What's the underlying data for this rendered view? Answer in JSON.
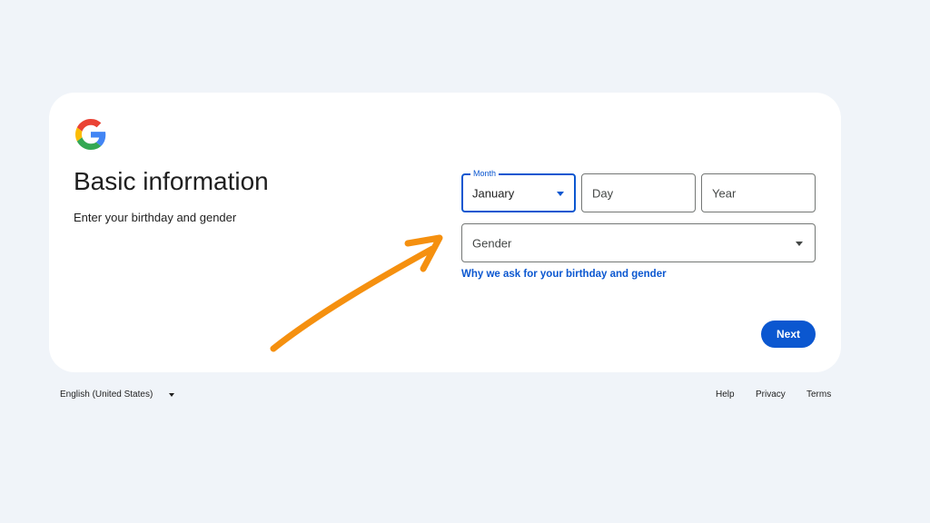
{
  "page": {
    "title": "Basic information",
    "subtitle": "Enter your birthday and gender"
  },
  "logo": {
    "icon": "google-logo-icon",
    "colors": [
      "#4285F4",
      "#EA4335",
      "#FBBC05",
      "#34A853"
    ]
  },
  "form": {
    "month": {
      "label": "Month",
      "value": "January"
    },
    "day": {
      "placeholder": "Day"
    },
    "year": {
      "placeholder": "Year"
    },
    "gender": {
      "placeholder": "Gender"
    },
    "why_link": "Why we ask for your birthday and gender",
    "next_label": "Next"
  },
  "footer": {
    "language": "English (United States)",
    "links": {
      "help": "Help",
      "privacy": "Privacy",
      "terms": "Terms"
    }
  },
  "colors": {
    "background": "#f0f4f9",
    "accent": "#0b57d0",
    "annotation_arrow": "#f5900f"
  }
}
